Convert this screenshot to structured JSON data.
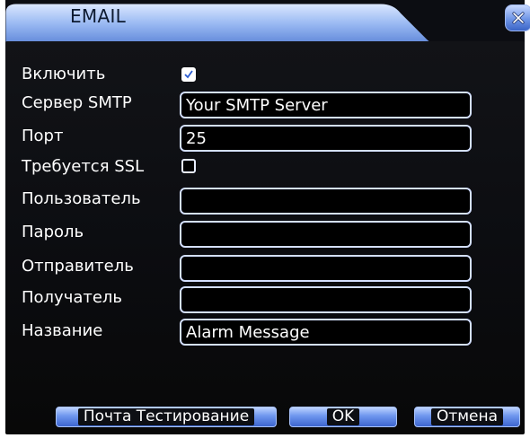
{
  "window": {
    "title": "EMAIL"
  },
  "form": {
    "enable": {
      "label": "Включить",
      "checked": true
    },
    "smtp_server": {
      "label": "Сервер SMTP",
      "value": "Your SMTP Server"
    },
    "port": {
      "label": "Порт",
      "value": "25"
    },
    "ssl": {
      "label": "Требуется SSL",
      "checked": false
    },
    "user": {
      "label": "Пользователь",
      "value": ""
    },
    "password": {
      "label": "Пароль",
      "value": ""
    },
    "sender": {
      "label": "Отправитель",
      "value": ""
    },
    "recipient": {
      "label": "Получатель",
      "value": ""
    },
    "subject": {
      "label": "Название",
      "value": "Alarm Message"
    }
  },
  "buttons": {
    "test": "Почта Тестирование",
    "ok": "OK",
    "cancel": "Отмена"
  },
  "colors": {
    "accent": "#6f95e6",
    "panel_bg": "#0c0d11",
    "field_border": "#d4e0ff"
  }
}
